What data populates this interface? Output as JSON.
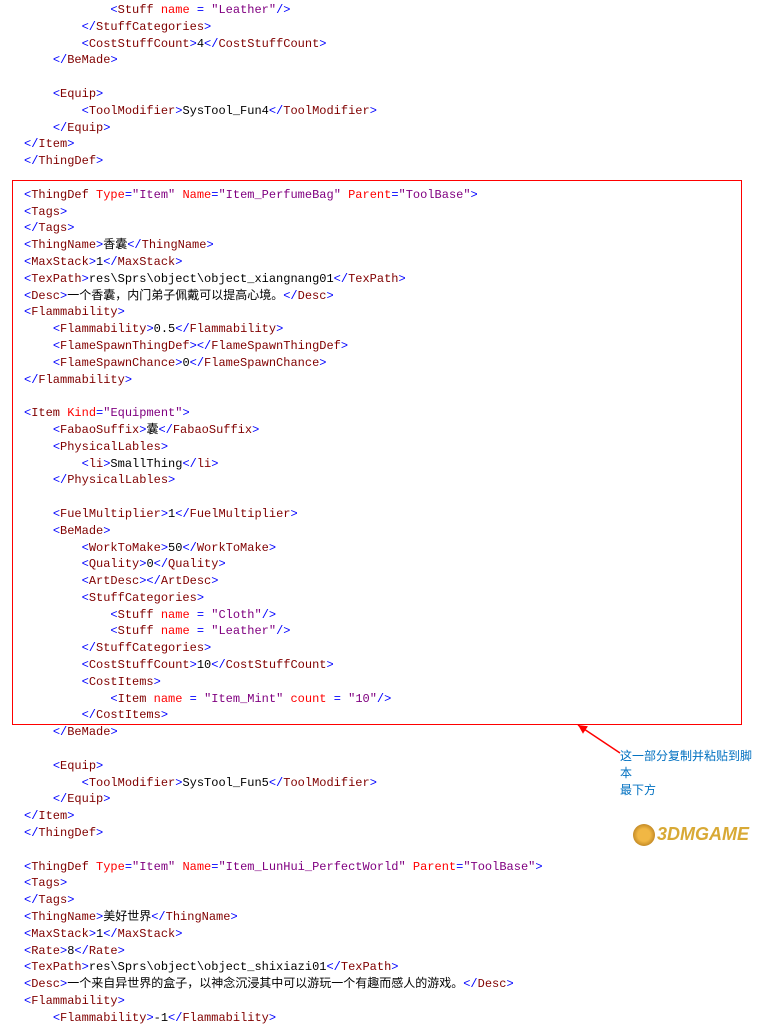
{
  "block1": {
    "l1_stuff_name_attr": "name",
    "l1_stuff_name_val": "Leather",
    "l2_close": "StuffCategories",
    "l3_open": "CostStuffCount",
    "l3_val": "4",
    "l3_close": "CostStuffCount",
    "l4_close": "BeMade",
    "l5_open": "Equip",
    "l6_open": "ToolModifier",
    "l6_val": "SysTool_Fun4",
    "l6_close": "ToolModifier",
    "l7_close": "Equip",
    "l8_close": "Item",
    "l9_close": "ThingDef"
  },
  "block2": {
    "thingdef_type_attr": "Type",
    "thingdef_type_val": "Item",
    "thingdef_name_attr": "Name",
    "thingdef_name_val": "Item_PerfumeBag",
    "thingdef_parent_attr": "Parent",
    "thingdef_parent_val": "ToolBase",
    "tags_open": "Tags",
    "tags_close": "Tags",
    "thingname_open": "ThingName",
    "thingname_val": "香囊",
    "thingname_close": "ThingName",
    "maxstack_open": "MaxStack",
    "maxstack_val": "1",
    "maxstack_close": "MaxStack",
    "texpath_open": "TexPath",
    "texpath_val": "res\\Sprs\\object\\object_xiangnang01",
    "texpath_close": "TexPath",
    "desc_open": "Desc",
    "desc_val": "一个香囊，内门弟子佩戴可以提高心境。",
    "desc_close": "Desc",
    "flam_open": "Flammability",
    "flam_inner_open": "Flammability",
    "flam_inner_val": "0.5",
    "flam_inner_close": "Flammability",
    "flamespawn_open": "FlameSpawnThingDef",
    "flamespawn_close": "FlameSpawnThingDef",
    "flamechance_open": "FlameSpawnChance",
    "flamechance_val": "0",
    "flamechance_close": "FlameSpawnChance",
    "flam_close": "Flammability",
    "item_kind_attr": "Kind",
    "item_kind_val": "Equipment",
    "fabao_open": "FabaoSuffix",
    "fabao_val": "囊",
    "fabao_close": "FabaoSuffix",
    "phys_open": "PhysicalLables",
    "li_open": "li",
    "li_val": "SmallThing",
    "li_close": "li",
    "phys_close": "PhysicalLables",
    "fuel_open": "FuelMultiplier",
    "fuel_val": "1",
    "fuel_close": "FuelMultiplier",
    "bemade_open": "BeMade",
    "work_open": "WorkToMake",
    "work_val": "50",
    "work_close": "WorkToMake",
    "quality_open": "Quality",
    "quality_val": "0",
    "quality_close": "Quality",
    "artdesc_open": "ArtDesc",
    "artdesc_close": "ArtDesc",
    "stuffcat_open": "StuffCategories",
    "stuff1_attr": "name",
    "stuff1_val": "Cloth",
    "stuff2_attr": "name",
    "stuff2_val": "Leather",
    "stuffcat_close": "StuffCategories",
    "coststuff_open": "CostStuffCount",
    "coststuff_val": "10",
    "coststuff_close": "CostStuffCount",
    "costitems_open": "CostItems",
    "costitem_name_attr": "name",
    "costitem_name_val": "Item_Mint",
    "costitem_count_attr": "count",
    "costitem_count_val": "10",
    "costitems_close": "CostItems",
    "bemade_close": "BeMade",
    "equip_open": "Equip",
    "toolmod_open": "ToolModifier",
    "toolmod_val": "SysTool_Fun5",
    "toolmod_close": "ToolModifier",
    "equip_close": "Equip",
    "item_close": "Item",
    "thingdef_close": "ThingDef"
  },
  "block3": {
    "thingdef_type_attr": "Type",
    "thingdef_type_val": "Item",
    "thingdef_name_attr": "Name",
    "thingdef_name_val": "Item_LunHui_PerfectWorld",
    "thingdef_parent_attr": "Parent",
    "thingdef_parent_val": "ToolBase",
    "tags_open": "Tags",
    "tags_close": "Tags",
    "thingname_open": "ThingName",
    "thingname_val": "美好世界",
    "thingname_close": "ThingName",
    "maxstack_open": "MaxStack",
    "maxstack_val": "1",
    "maxstack_close": "MaxStack",
    "rate_open": "Rate",
    "rate_val": "8",
    "rate_close": "Rate",
    "texpath_open": "TexPath",
    "texpath_val": "res\\Sprs\\object\\object_shixiazi01",
    "texpath_close": "TexPath",
    "desc_open": "Desc",
    "desc_val": "一个来自异世界的盒子，以神念沉浸其中可以游玩一个有趣而感人的游戏。",
    "desc_close": "Desc",
    "flam_open": "Flammability",
    "flam_inner_open": "Flammability",
    "flam_inner_val": "-1",
    "flam_inner_close": "Flammability"
  },
  "annotation": {
    "line1": "这一部分复制并粘贴到脚本",
    "line2": "最下方"
  },
  "watermark": "3DMGAME"
}
